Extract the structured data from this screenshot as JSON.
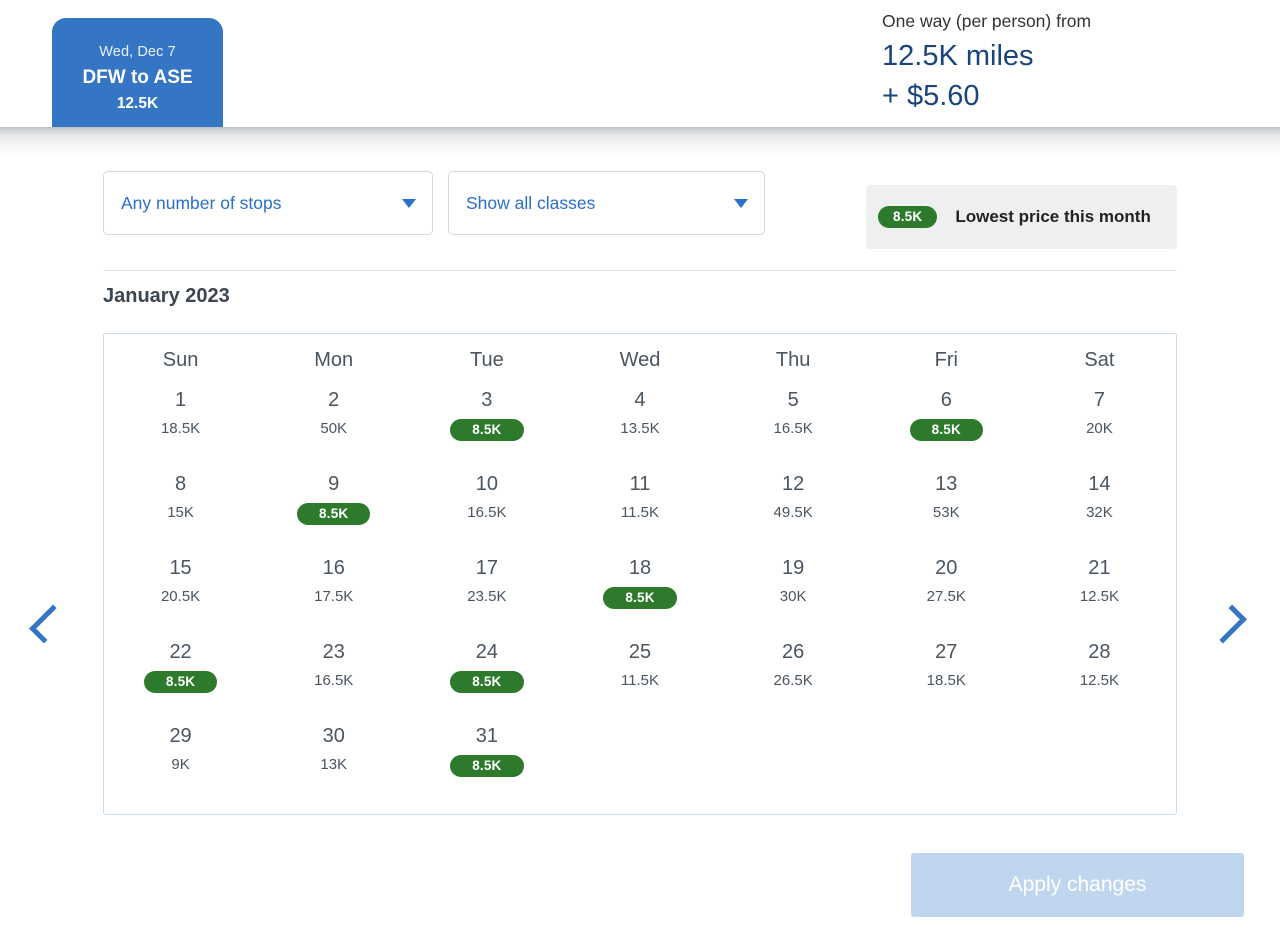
{
  "header": {
    "trip_tab": {
      "date": "Wed, Dec 7",
      "route": "DFW to ASE",
      "price": "12.5K"
    },
    "price_summary": {
      "label": "One way (per person) from",
      "miles": "12.5K miles",
      "fee": "+ $5.60"
    }
  },
  "filters": {
    "stops": {
      "value": "Any number of stops",
      "caret_icon": "chevron-down-icon"
    },
    "classes": {
      "value": "Show all classes",
      "caret_icon": "chevron-down-icon"
    },
    "legend": {
      "badge": "8.5K",
      "text": "Lowest price this month"
    }
  },
  "calendar": {
    "month_title": "January 2023",
    "day_headers": [
      "Sun",
      "Mon",
      "Tue",
      "Wed",
      "Thu",
      "Fri",
      "Sat"
    ],
    "prev_icon": "chevron-left-icon",
    "next_icon": "chevron-right-icon",
    "weeks": [
      [
        {
          "day": "1",
          "price": "18.5K",
          "lowest": false
        },
        {
          "day": "2",
          "price": "50K",
          "lowest": false
        },
        {
          "day": "3",
          "price": "8.5K",
          "lowest": true
        },
        {
          "day": "4",
          "price": "13.5K",
          "lowest": false
        },
        {
          "day": "5",
          "price": "16.5K",
          "lowest": false
        },
        {
          "day": "6",
          "price": "8.5K",
          "lowest": true
        },
        {
          "day": "7",
          "price": "20K",
          "lowest": false
        }
      ],
      [
        {
          "day": "8",
          "price": "15K",
          "lowest": false
        },
        {
          "day": "9",
          "price": "8.5K",
          "lowest": true
        },
        {
          "day": "10",
          "price": "16.5K",
          "lowest": false
        },
        {
          "day": "11",
          "price": "11.5K",
          "lowest": false
        },
        {
          "day": "12",
          "price": "49.5K",
          "lowest": false
        },
        {
          "day": "13",
          "price": "53K",
          "lowest": false
        },
        {
          "day": "14",
          "price": "32K",
          "lowest": false
        }
      ],
      [
        {
          "day": "15",
          "price": "20.5K",
          "lowest": false
        },
        {
          "day": "16",
          "price": "17.5K",
          "lowest": false
        },
        {
          "day": "17",
          "price": "23.5K",
          "lowest": false
        },
        {
          "day": "18",
          "price": "8.5K",
          "lowest": true
        },
        {
          "day": "19",
          "price": "30K",
          "lowest": false
        },
        {
          "day": "20",
          "price": "27.5K",
          "lowest": false
        },
        {
          "day": "21",
          "price": "12.5K",
          "lowest": false
        }
      ],
      [
        {
          "day": "22",
          "price": "8.5K",
          "lowest": true
        },
        {
          "day": "23",
          "price": "16.5K",
          "lowest": false
        },
        {
          "day": "24",
          "price": "8.5K",
          "lowest": true
        },
        {
          "day": "25",
          "price": "11.5K",
          "lowest": false
        },
        {
          "day": "26",
          "price": "26.5K",
          "lowest": false
        },
        {
          "day": "27",
          "price": "18.5K",
          "lowest": false
        },
        {
          "day": "28",
          "price": "12.5K",
          "lowest": false
        }
      ],
      [
        {
          "day": "29",
          "price": "9K",
          "lowest": false
        },
        {
          "day": "30",
          "price": "13K",
          "lowest": false
        },
        {
          "day": "31",
          "price": "8.5K",
          "lowest": true
        },
        {
          "day": "",
          "price": "",
          "lowest": false
        },
        {
          "day": "",
          "price": "",
          "lowest": false
        },
        {
          "day": "",
          "price": "",
          "lowest": false
        },
        {
          "day": "",
          "price": "",
          "lowest": false
        }
      ]
    ]
  },
  "footer": {
    "apply_label": "Apply changes"
  },
  "colors": {
    "brand_blue": "#3476c4",
    "deep_blue": "#19447e",
    "link_blue": "#2a6fc9",
    "lowest_green": "#2d7a2d",
    "apply_disabled": "#bfd6ee",
    "calendar_border": "#c9dcee"
  }
}
